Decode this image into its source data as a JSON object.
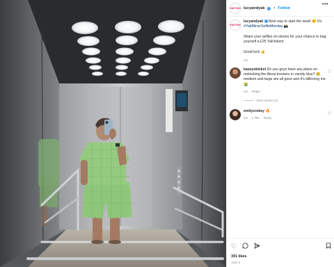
{
  "post": {
    "username": "lucyandyak",
    "verified_badge": "✓",
    "follow_label": "Follow",
    "more_icon": "more-options-icon",
    "avatar_text": "YAK YAK",
    "avatar_line1": "YAK",
    "avatar_line2": "YAK"
  },
  "caption": {
    "username": "lucyandyak",
    "line1": "Best way to start the week 🌞 It's",
    "hashtag": "#YakMirrorSelfieMonday",
    "hashtag_suffix": " 📸",
    "paragraph2": "Share your selfies on stories for your chance to bag yourself a £25 Yak'tokent",
    "paragraph3": "Good luck 👍",
    "time": "1w"
  },
  "comments": [
    {
      "username": "kaseysbickel",
      "text": "Do you guys have any plans on restocking the Alexa trousers in varsity blue? 😢 medium and large are all gone and it's killinning me 😭",
      "time": "1w",
      "reply_label": "Reply",
      "view_replies": "View replies (1)"
    },
    {
      "username": "emilycrokey",
      "text": "🔥",
      "time": "1w",
      "likes": "1 like",
      "reply_label": "Reply"
    }
  ],
  "actions": {
    "like_icon": "heart-icon",
    "comment_icon": "comment-icon",
    "share_icon": "share-icon",
    "save_icon": "bookmark-icon"
  },
  "likes_text": "391 likes",
  "date_text": "June 2",
  "colors": {
    "link_blue": "#0095f6",
    "hashtag_blue": "#00376b",
    "muted": "#8e8e8e",
    "outfit_green": "#8fc77a"
  }
}
